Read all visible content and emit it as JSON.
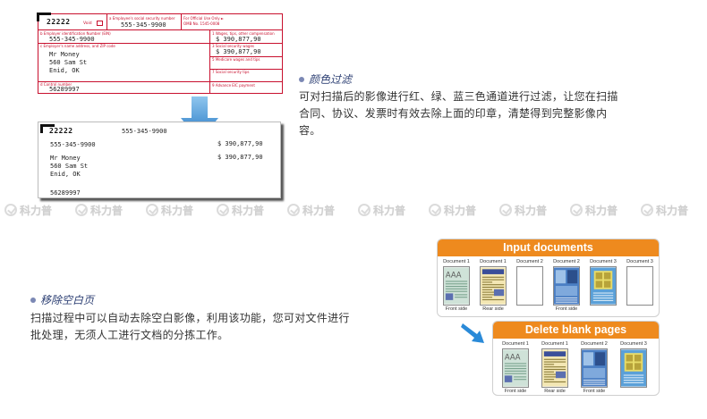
{
  "w2_form": {
    "code": "22222",
    "void_label": "Void",
    "ssn_label": "a Employee's social security number",
    "ssn_value": "555-345-9900",
    "omb_label": "For Official Use Only ►",
    "omb_number": "OMB No. 1545-0008",
    "ein_label": "b Employer identification Number (EIN)",
    "ein_value": "555-345-9900",
    "wages_label": "1 Wages, tips, other compensation",
    "wages_value": "$ 390,877,90",
    "employer_label": "c Employer's name address, and ZIP code",
    "employer_name": "Mr Money",
    "employer_street": "560 Sam St",
    "employer_city": "Enid, OK",
    "ss_wages_label": "3 Social security wages",
    "ss_wages_value": "$ 390,877,90",
    "medicare_label": "5 Medicare wages and tips",
    "ss_tips_label": "7 Social security tips",
    "control_label": "d Control number",
    "control_value": "56289997",
    "eic_label": "9 Advance EIC payment"
  },
  "filtered_form": {
    "code": "22222",
    "ssn_value": "555-345-9900",
    "ein_value": "555-345-9900",
    "wages_value": "$ 390,877,90",
    "ss_wages_value": "$ 390,877,90",
    "employer_name": "Mr Money",
    "employer_street": "560 Sam St",
    "employer_city": "Enid, OK",
    "control_value": "56289997"
  },
  "color_filter": {
    "title": "颜色过滤",
    "line1": "可对扫描后的影像进行红、绿、蓝三色通道进行过滤，让您在扫描",
    "line2": "合同、协议、发票时有效去除上面的印章，清楚得到完整影像内",
    "line3": "容。"
  },
  "blank_removal": {
    "title": "移除空白页",
    "line1": "扫描过程中可以自动去除空白影像，利用该功能，您可对文件进行",
    "line2": "批处理，无须人工进行文档的分拣工作。"
  },
  "watermark": {
    "text": "科力普",
    "count": 10
  },
  "input_panel": {
    "title": "Input documents",
    "columns": [
      {
        "doc": "Document 1",
        "side": "Front side"
      },
      {
        "doc": "Document 1",
        "side": "Rear side"
      },
      {
        "doc": "Document 2",
        "side": ""
      },
      {
        "doc": "Document 2",
        "side": "Front side"
      },
      {
        "doc": "Document 3",
        "side": ""
      },
      {
        "doc": "Document 3",
        "side": ""
      }
    ]
  },
  "delete_panel": {
    "title": "Delete blank pages",
    "columns": [
      {
        "doc": "Document 1",
        "side": "Front side"
      },
      {
        "doc": "Document 1",
        "side": "Rear side"
      },
      {
        "doc": "Document 2",
        "side": "Front side"
      },
      {
        "doc": "Document 3",
        "side": ""
      }
    ]
  },
  "colors": {
    "form_red": "#c8102e",
    "accent_blue": "#2a7fc9",
    "panel_orange": "#ee8a1e",
    "title_navy": "#2c3f73"
  }
}
